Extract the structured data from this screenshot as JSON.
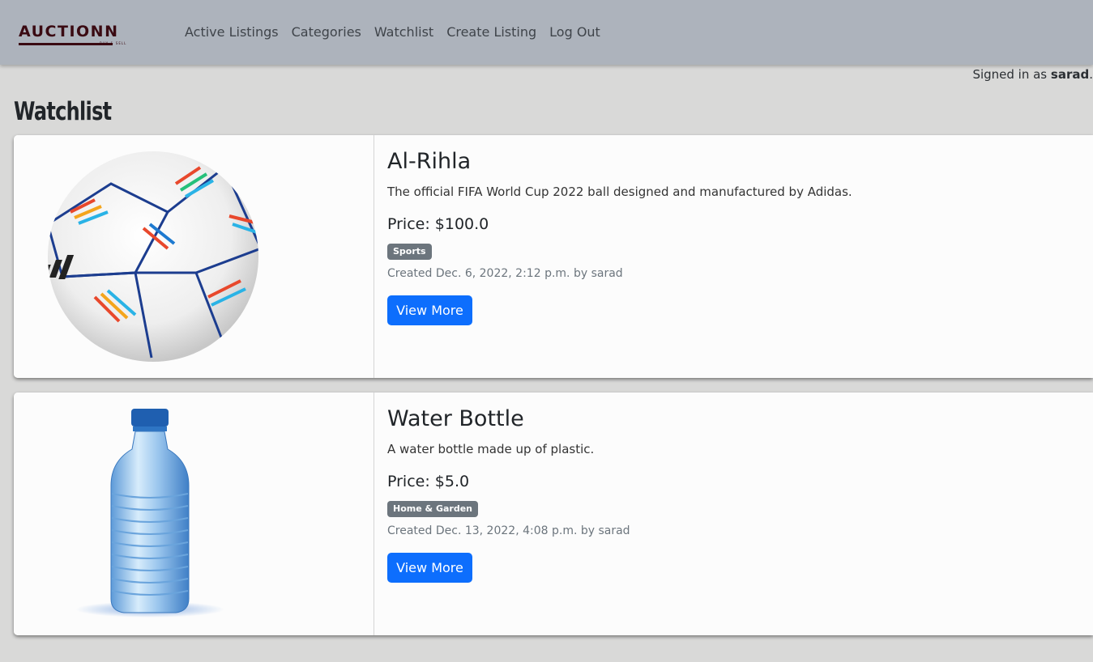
{
  "brand": {
    "name": "AUCTIONN",
    "tagline": "BUY & SELL"
  },
  "nav": {
    "items": [
      {
        "label": "Active Listings"
      },
      {
        "label": "Categories"
      },
      {
        "label": "Watchlist"
      },
      {
        "label": "Create Listing"
      },
      {
        "label": "Log Out"
      }
    ]
  },
  "user": {
    "signed_in_prefix": "Signed in as",
    "username": "sarad",
    "suffix": "."
  },
  "page": {
    "title": "Watchlist"
  },
  "listings": [
    {
      "title": "Al-Rihla",
      "description": "The official FIFA World Cup 2022 ball designed and manufactured by Adidas.",
      "price": "Price: $100.0",
      "category": "Sports",
      "created": "Created Dec. 6, 2022, 2:12 p.m. by sarad",
      "button": "View More",
      "image_icon": "soccer-ball-icon"
    },
    {
      "title": "Water Bottle",
      "description": "A water bottle made up of plastic.",
      "price": "Price: $5.0",
      "category": "Home & Garden",
      "created": "Created Dec. 13, 2022, 4:08 p.m. by sarad",
      "button": "View More",
      "image_icon": "water-bottle-icon"
    }
  ],
  "colors": {
    "navbar": "#adb3bc",
    "background": "#d9d9d8",
    "primary_button": "#0d6efd",
    "badge": "#6c757d",
    "brand": "#3a0a12"
  }
}
